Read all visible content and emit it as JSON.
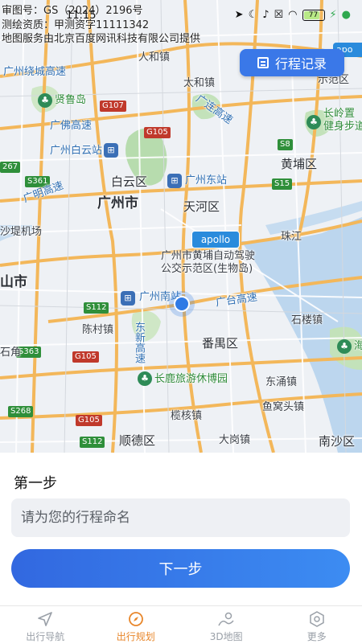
{
  "status_bar": {
    "time": "11:15",
    "battery": "77"
  },
  "map": {
    "copyright_lines": [
      "审图号：GS（2024）2196号",
      "测绘资质：甲测资字11111342",
      "地图服务由北京百度网讯科技有限公司提供"
    ],
    "labels": {
      "guangzhou_ring_expressway": "广州绕城高速",
      "renhe": "人和镇",
      "taihe": "太和镇",
      "xianlu_lake": "贤鲁岛",
      "guangfo_expressway": "广佛高速",
      "guangzhou_baiyun_station": "广州白云站",
      "guangming_expressway": "广明高速",
      "baiyun_district": "白云区",
      "guangzhou_city": "广州市",
      "guangzhou_east_station": "广州东站",
      "tianhe_district": "天河区",
      "guangzhou_airport": "沙堤机场",
      "apollo_area": "广州市黄埔自动驾驶\n公交示范区(生物岛)",
      "guangzhou_south": "广州南站",
      "chencun": "陈村镇",
      "panyu": "番禺区",
      "guangtai_expressway": "广台高速",
      "dongxin_expressway": "东新高速",
      "changlu_museum": "长鹿旅游休博园",
      "nancun": "南村镇",
      "shunde": "顺德区",
      "lanhe": "榄核镇",
      "dagang": "大岗镇",
      "nansha": "南沙区",
      "dongchong": "东涌镇",
      "yuwotou": "鱼窝头镇",
      "shilou": "石楼镇",
      "huangpu": "黄埔区",
      "zhujiang": "珠江",
      "lianhua_expressway": "广连高速",
      "changling": "长岭置",
      "jianshen": "健身步道",
      "foshan_city": "山市",
      "shijiao": "石角",
      "hai": "海",
      "guanbu": "示范区"
    },
    "highway_badges": [
      "G107",
      "G105",
      "S8",
      "S15",
      "S361",
      "S112",
      "S363",
      "G105",
      "S268",
      "G105",
      "S112",
      "267"
    ],
    "apollo_tag": "apollo"
  },
  "trip_record_button": "行程记录",
  "step": {
    "title": "第一步",
    "name_placeholder": "请为您的行程命名",
    "next_label": "下一步"
  },
  "tabs": [
    {
      "label": "出行导航",
      "icon": "navigation-arrow-icon",
      "active": false
    },
    {
      "label": "出行规划",
      "icon": "compass-icon",
      "active": true
    },
    {
      "label": "3D地图",
      "icon": "3d-map-icon",
      "active": false
    },
    {
      "label": "更多",
      "icon": "more-hexagon-icon",
      "active": false
    }
  ],
  "colors": {
    "accent": "#3a78e8",
    "active_tab": "#e8862a"
  }
}
